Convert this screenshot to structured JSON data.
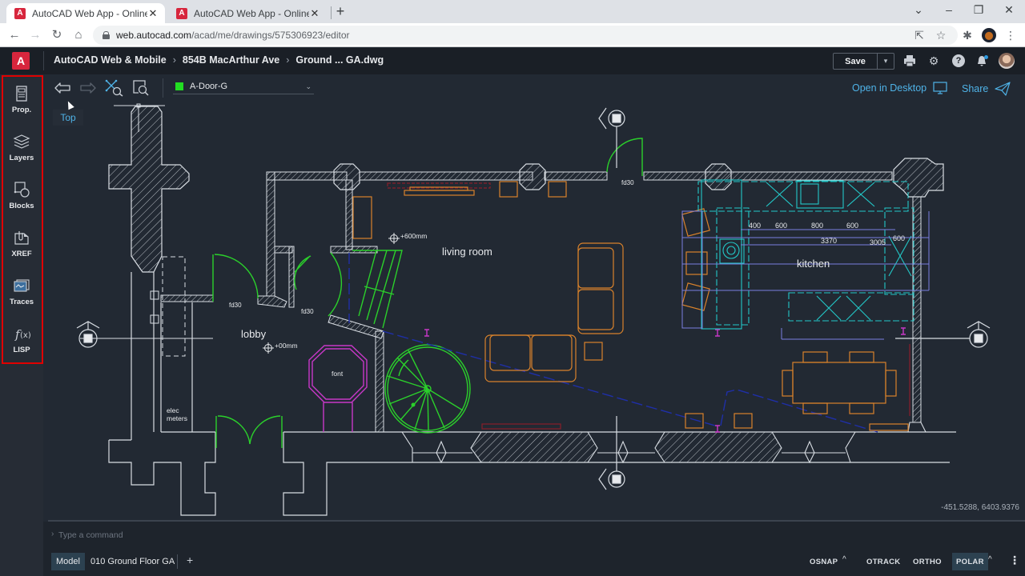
{
  "browser": {
    "tabs": [
      {
        "title": "AutoCAD Web App - Online CAD",
        "active": true,
        "favicon": "A"
      },
      {
        "title": "AutoCAD Web App - Online CAD",
        "active": false,
        "favicon": "A"
      }
    ],
    "new_tab": "+",
    "url_domain": "web.autocad.com",
    "url_path": "/acad/me/drawings/575306923/editor",
    "window_controls": {
      "tab_search": "⌄",
      "minimize": "–",
      "restore": "❐",
      "close": "✕"
    },
    "nav": {
      "back": "←",
      "forward": "→",
      "reload": "↻",
      "home": "⌂"
    },
    "toolbar_icons": {
      "share": "⇱",
      "bookmark": "☆",
      "extensions": "✱",
      "menu": "⋮"
    }
  },
  "app": {
    "logo": "A",
    "breadcrumb": [
      "AutoCAD Web & Mobile",
      "854B MacArthur Ave",
      "Ground ... GA.dwg"
    ],
    "breadcrumb_sep": "›",
    "save_label": "Save",
    "save_dropdown": "▾",
    "header_icons": {
      "print": "🖶",
      "settings": "⚙",
      "help": "?",
      "notifications": "🔔"
    }
  },
  "sidebar": {
    "items": [
      {
        "label": "Prop.",
        "icon": "properties-icon"
      },
      {
        "label": "Layers",
        "icon": "layers-icon"
      },
      {
        "label": "Blocks",
        "icon": "blocks-icon"
      },
      {
        "label": "XREF",
        "icon": "xref-icon"
      },
      {
        "label": "Traces",
        "icon": "traces-icon"
      },
      {
        "label": "LISP",
        "icon": "lisp-icon"
      }
    ]
  },
  "drawing_toolbar": {
    "current_layer": "A-Door-G",
    "layer_color": "#22dd22",
    "layer_chevron": "⌄",
    "open_in_desktop": "Open in Desktop",
    "share": "Share"
  },
  "tooltip": "Top",
  "canvas": {
    "room_labels": {
      "living_room": "living room",
      "kitchen": "kitchen",
      "lobby": "lobby",
      "font": "font",
      "elec_meters_1": "elec",
      "elec_meters_2": "meters"
    },
    "level_markers": {
      "living": "+600mm",
      "lobby": "+00mm"
    },
    "door_tags": [
      "fd30",
      "fd30",
      "fd30"
    ],
    "dimensions": {
      "d1": "400",
      "d2": "600",
      "d3": "800",
      "d4": "600",
      "total": "3370",
      "side": "3005",
      "right": "600"
    },
    "coordinates": "-451.5288, 6403.9376"
  },
  "command_line": {
    "prompt": "›",
    "placeholder": "Type a command"
  },
  "statusbar": {
    "model_tab": "Model",
    "layout_tab": "010 Ground Floor GA",
    "add_layout": "+",
    "toggles": [
      {
        "label": "OSNAP",
        "on": false
      },
      {
        "label": "OTRACK",
        "on": false
      },
      {
        "label": "ORTHO",
        "on": false
      },
      {
        "label": "POLAR",
        "on": true
      }
    ],
    "caret": "^",
    "more": "⋮"
  },
  "colors": {
    "accent": "#4fb3e8",
    "brand": "#d7263d",
    "highlight_outline": "#e00000",
    "walls": "#d8dde3",
    "doors": "#2bd02b",
    "furniture": "#d9822b",
    "kitchen": "#22c8c8",
    "dims": "#7b7fe0",
    "font_feature": "#c838c8",
    "guide": "#1f2fa8"
  }
}
